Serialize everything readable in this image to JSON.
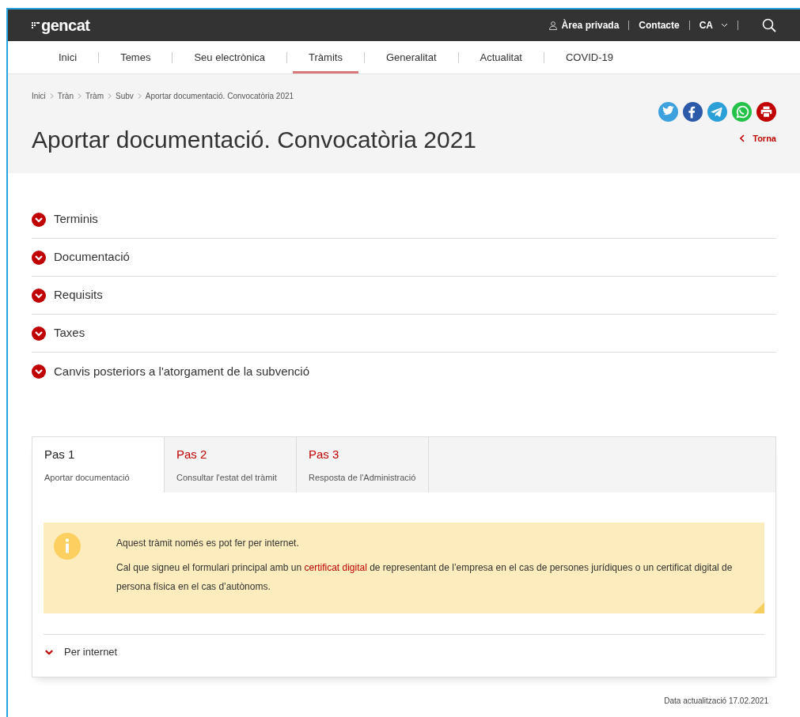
{
  "header": {
    "logo": "gencat",
    "links": [
      {
        "kind": "user",
        "label": "Àrea privada"
      },
      {
        "kind": "plain",
        "label": "Contacte"
      },
      {
        "kind": "lang",
        "label": "CA"
      }
    ]
  },
  "nav": [
    {
      "label": "Inici",
      "selected": false
    },
    {
      "label": "Temes",
      "selected": false
    },
    {
      "label": "Seu electrònica",
      "selected": false
    },
    {
      "label": "Tràmits",
      "selected": true
    },
    {
      "label": "Generalitat",
      "selected": false
    },
    {
      "label": "Actualitat",
      "selected": false
    },
    {
      "label": "COVID-19",
      "selected": false
    }
  ],
  "breadcrumbs": [
    "Inici",
    "Tràn",
    "Tràm",
    "Subv",
    "Aportar documentació. Convocatòria 2021"
  ],
  "title": "Aportar documentació. Convocatòria 2021",
  "share": [
    {
      "kind": "twitter",
      "color": "#3ca1dc"
    },
    {
      "kind": "facebook",
      "color": "#2c5aa8"
    },
    {
      "kind": "telegram",
      "color": "#2a9fd8"
    },
    {
      "kind": "whatsapp",
      "color": "#25c24a"
    },
    {
      "kind": "print",
      "color": "#c00000"
    }
  ],
  "back": "Torna",
  "sections": [
    {
      "label": "Terminis",
      "expanded": false
    },
    {
      "label": "Documentació",
      "expanded": false
    },
    {
      "label": "Requisits",
      "expanded": false
    },
    {
      "label": "Taxes",
      "expanded": false
    },
    {
      "label": "Canvis posteriors a l'atorgament de la subvenció",
      "expanded": false
    }
  ],
  "steps": [
    {
      "label": "Pas 1",
      "subtitle": "Aportar documentació",
      "selected": true
    },
    {
      "label": "Pas 2",
      "subtitle": "Consultar l'estat del tràmit",
      "selected": false
    },
    {
      "label": "Pas 3",
      "subtitle": "Resposta de l'Administració",
      "selected": false
    }
  ],
  "notice": {
    "line": "Aquest tràmit només es pot fer per internet.",
    "before": "Cal que signeu el formulari principal amb un",
    "link": "certificat digital",
    "after": "de representant de l’empresa en el cas de persones jurídiques o un certificat digital de persona física en el cas d’autònoms."
  },
  "channel": {
    "label": "Per internet",
    "expanded": false
  },
  "updated": "Data actualització 17.02.2021"
}
